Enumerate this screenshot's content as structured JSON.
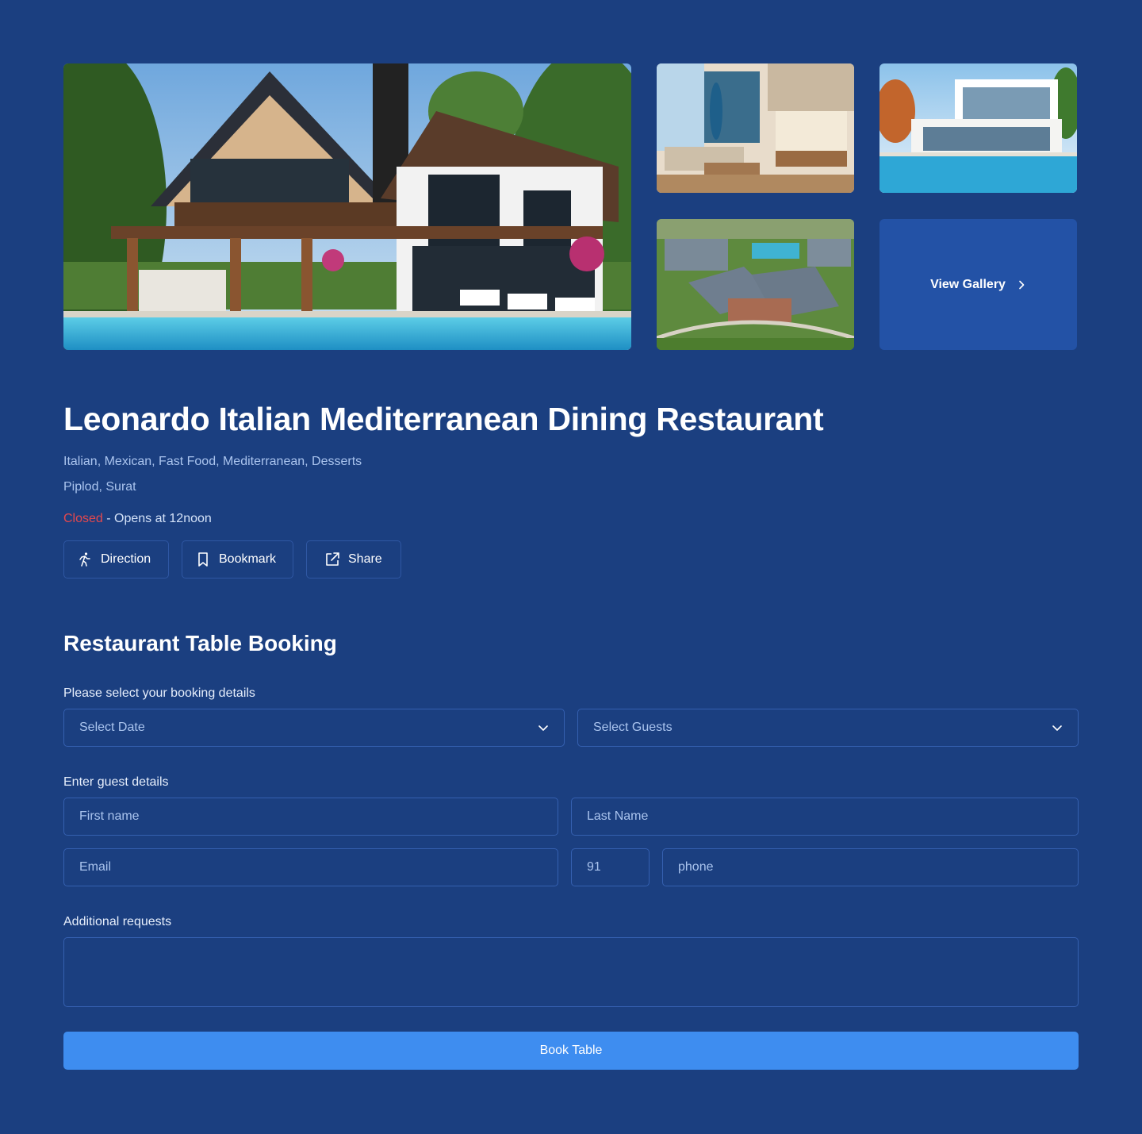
{
  "gallery": {
    "view_gallery_label": "View Gallery",
    "images": [
      {
        "name": "main-house-photo"
      },
      {
        "name": "living-room-photo"
      },
      {
        "name": "pool-villa-photo"
      },
      {
        "name": "aerial-resort-photo"
      }
    ]
  },
  "restaurant": {
    "name": "Leonardo Italian Mediterranean Dining Restaurant",
    "cuisines": "Italian, Mexican, Fast Food, Mediterranean, Desserts",
    "location": "Piplod, Surat",
    "status": "Closed",
    "status_detail": " - Opens at 12noon",
    "status_color": "#e5484d"
  },
  "actions": {
    "direction_label": "Direction",
    "bookmark_label": "Bookmark",
    "share_label": "Share"
  },
  "booking": {
    "title": "Restaurant Table Booking",
    "details_label": "Please select your booking details",
    "date_placeholder": "Select Date",
    "guests_placeholder": "Select Guests",
    "guest_label": "Enter guest details",
    "first_name_placeholder": "First name",
    "last_name_placeholder": "Last Name",
    "email_placeholder": "Email",
    "country_code": "91",
    "phone_placeholder": "phone",
    "additional_label": "Additional requests",
    "additional_placeholder": "",
    "submit_label": "Book Table"
  },
  "colors": {
    "background": "#1b3f80",
    "accent": "#3e8df0",
    "panel": "#2352a6"
  }
}
